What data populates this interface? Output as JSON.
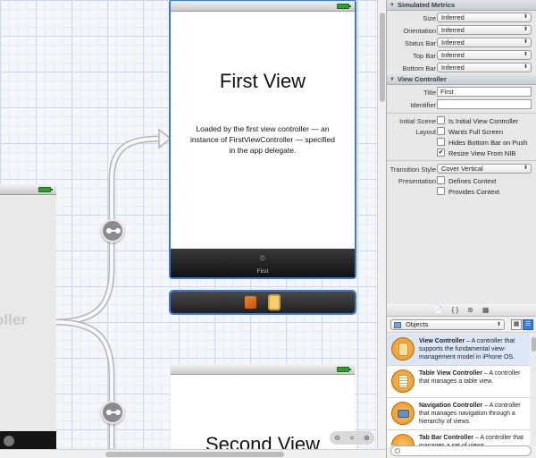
{
  "canvas": {
    "first_view": {
      "title": "First View",
      "description": "Loaded by the first view controller — an instance of FirstViewController — specified in the app delegate.",
      "tab_label": "First"
    },
    "tab_bar_controller": {
      "ghost_title": "oller"
    },
    "second_view": {
      "title": "Second View"
    }
  },
  "inspector": {
    "simulated_metrics": {
      "header": "Simulated Metrics",
      "rows": [
        {
          "label": "Size",
          "value": "Inferred"
        },
        {
          "label": "Orientation",
          "value": "Inferred"
        },
        {
          "label": "Status Bar",
          "value": "Inferred"
        },
        {
          "label": "Top Bar",
          "value": "Inferred"
        },
        {
          "label": "Bottom Bar",
          "value": "Inferred"
        }
      ]
    },
    "view_controller": {
      "header": "View Controller",
      "title_label": "Title",
      "title_value": "First",
      "identifier_label": "Identifier",
      "identifier_value": "",
      "initial_scene_label": "Initial Scene",
      "is_initial_label": "Is Initial View Controller",
      "layout_label": "Layout",
      "wants_full_screen_label": "Wants Full Screen",
      "hides_bottom_bar_label": "Hides Bottom Bar on Push",
      "resize_view_label": "Resize View From NIB",
      "resize_view_checked": true,
      "transition_style_label": "Transition Style",
      "transition_style_value": "Cover Vertical",
      "presentation_label": "Presentation",
      "defines_context_label": "Defines Context",
      "provides_context_label": "Provides Context"
    }
  },
  "library": {
    "tab_icons": [
      "📄",
      "{ }",
      "⊛",
      "▦"
    ],
    "category": "Objects",
    "items": [
      {
        "name": "View Controller",
        "desc": " – A controller that supports the fundamental view-management model in iPhone OS.",
        "icon": "view-controller-icon"
      },
      {
        "name": "Table View Controller",
        "desc": " – A controller that manages a table view.",
        "icon": "table-view-controller-icon"
      },
      {
        "name": "Navigation Controller",
        "desc": " – A controller that manages navigation through a hierarchy of views.",
        "icon": "navigation-controller-icon"
      },
      {
        "name": "Tab Bar Controller",
        "desc": " – A controller that manages a set of views",
        "icon": "tab-bar-controller-icon"
      }
    ]
  },
  "colors": {
    "selection": "#3b78d8",
    "accent": "#f0a030"
  }
}
